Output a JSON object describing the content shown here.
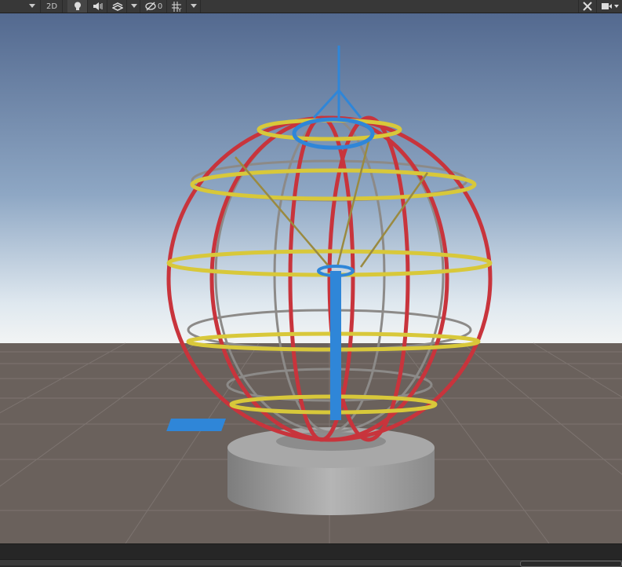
{
  "toolbar": {
    "mode_2d_label": "2D",
    "hidden_count": "0",
    "icons": [
      "shading-dropdown",
      "lighting-icon",
      "audio-icon",
      "effects-icon",
      "visibility-icon",
      "grid-icon",
      "tools-icon",
      "camera-icon"
    ]
  },
  "colors": {
    "sky_top": "#53698f",
    "horizon": "#eef2f4",
    "ground": "#6a615c",
    "red_rings": "#c8343c",
    "yellow_rings": "#d8c83a",
    "blue_pole": "#2f86d8"
  }
}
